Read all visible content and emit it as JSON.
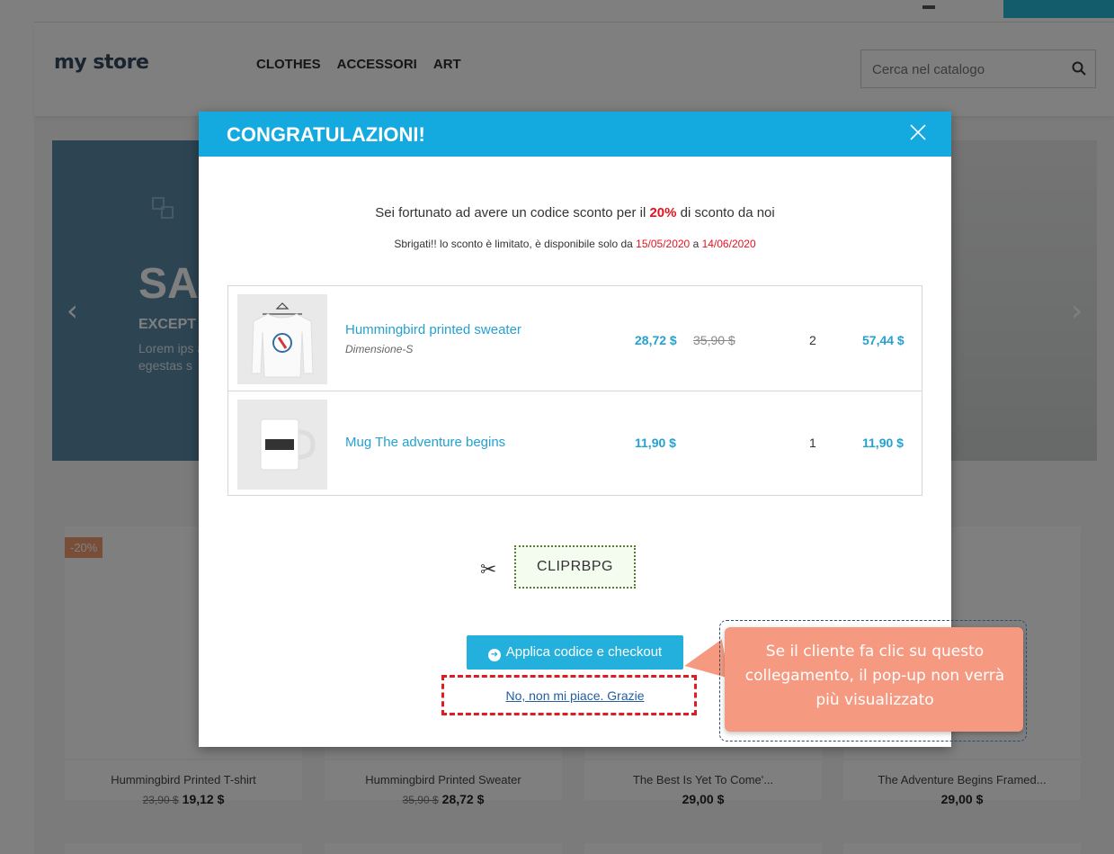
{
  "store": {
    "logo": "my store",
    "menu": [
      "CLOTHES",
      "ACCESSORI",
      "ART"
    ],
    "search_placeholder": "Cerca nel catalogo"
  },
  "slider": {
    "title": "SA",
    "subtitle": "EXCEPT",
    "text": "Lorem ips adipiscing dignissim egestas s"
  },
  "products": [
    {
      "name": "Hummingbird Printed T-shirt",
      "old_price": "23,90 $",
      "price": "19,12 $",
      "badge": "-20%"
    },
    {
      "name": "Hummingbird Printed Sweater",
      "old_price": "35,90 $",
      "price": "28,72 $"
    },
    {
      "name": "The Best Is Yet To Come'...",
      "price": "29,00 $"
    },
    {
      "name": "The Adventure Begins Framed...",
      "price": "29,00 $"
    }
  ],
  "modal": {
    "title": "CONGRATULAZIONI!",
    "message_prefix": "Sei fortunato ad avere un codice sconto per il ",
    "discount": "20%",
    "message_suffix": " di sconto da noi",
    "validity_prefix": "Sbrigati!! lo sconto è limitato, è disponibile solo da ",
    "date_from": "15/05/2020",
    "validity_mid": " a ",
    "date_to": "14/06/2020",
    "items": [
      {
        "name": "Hummingbird printed sweater",
        "attribute": "Dimensione-S",
        "price": "28,72 $",
        "old_price": "35,90 $",
        "qty": "2",
        "total": "57,44 $"
      },
      {
        "name": "Mug The adventure begins",
        "price": "11,90 $",
        "qty": "1",
        "total": "11,90 $"
      }
    ],
    "coupon_code": "CLIPRBPG",
    "apply_label": "Applica codice e checkout",
    "decline_label": "No, non mi piace. Grazie"
  },
  "callout": {
    "text": "Se il cliente fa clic su questo collegamento, il pop-up non verrà più visualizzato"
  },
  "colors": {
    "accent": "#14a9df",
    "button": "#24b0dc",
    "highlight": "#e8111f",
    "callout": "#f59a80"
  }
}
